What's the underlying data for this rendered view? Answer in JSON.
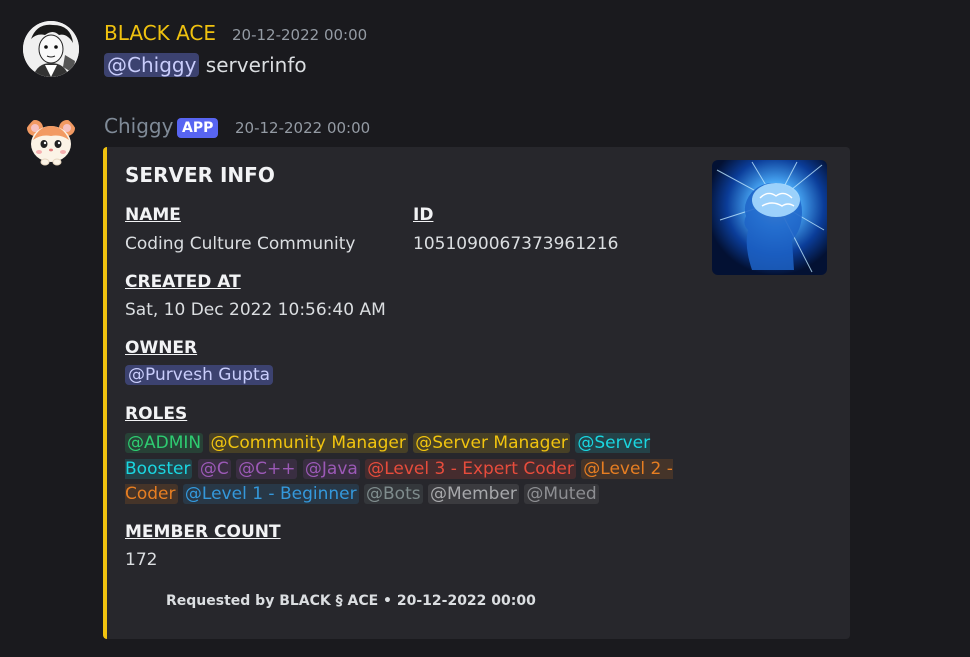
{
  "messages": [
    {
      "username": "BLACK ACE",
      "timestamp": "20-12-2022 00:00",
      "mention": "@Chiggy",
      "text": "serverinfo",
      "username_color": "#f0c20f"
    },
    {
      "username": "Chiggy",
      "badge": "APP",
      "timestamp": "20-12-2022 00:00",
      "username_color": "#7f8a97"
    }
  ],
  "embed": {
    "title": "SERVER INFO",
    "accent_color": "#f0c20f",
    "fields": {
      "name_label": "NAME",
      "name_value": "Coding Culture Community",
      "id_label": "ID",
      "id_value": "1051090067373961216",
      "created_label": "CREATED AT",
      "created_value": "Sat, 10 Dec 2022 10:56:40 AM",
      "owner_label": "OWNER",
      "owner_value": "@Purvesh Gupta",
      "roles_label": "ROLES",
      "member_count_label": "MEMBER COUNT",
      "member_count_value": "172"
    },
    "roles": [
      {
        "name": "@ADMIN",
        "color": "#2ecc71"
      },
      {
        "name": "@Community Manager",
        "color": "#f1c40f"
      },
      {
        "name": "@Server Manager",
        "color": "#f1c40f"
      },
      {
        "name": "@Server Booster",
        "color": "#1ad6e0"
      },
      {
        "name": "@C",
        "color": "#9b59b6"
      },
      {
        "name": "@C++",
        "color": "#9b59b6"
      },
      {
        "name": "@Java",
        "color": "#9b59b6"
      },
      {
        "name": "@Level 3 - Expert Coder",
        "color": "#e74c3c"
      },
      {
        "name": "@Level 2 - Coder",
        "color": "#e67e22"
      },
      {
        "name": "@Level 1 - Beginner",
        "color": "#3498db"
      },
      {
        "name": "@Bots",
        "color": "#7f8c8d"
      },
      {
        "name": "@Member",
        "color": "#a7a8ab"
      },
      {
        "name": "@Muted",
        "color": "#8d8e92"
      }
    ],
    "footer": "Requested by BLACK § ACE • 20-12-2022 00:00",
    "thumbnail_icon": "brain-head-image"
  }
}
